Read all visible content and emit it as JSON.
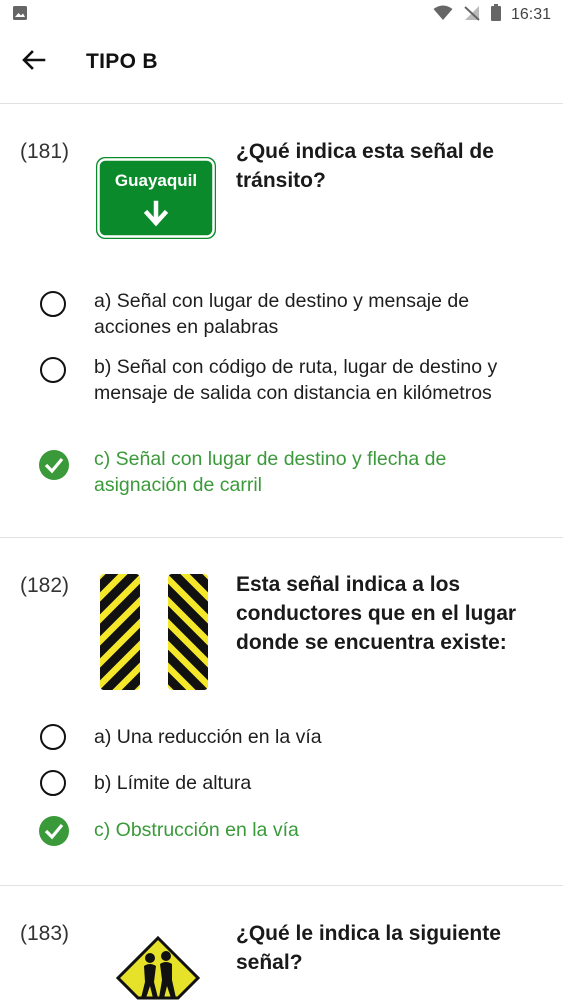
{
  "status_bar": {
    "time": "16:31",
    "icons": [
      "image-icon",
      "wifi-icon",
      "no-signal-icon",
      "battery-icon"
    ]
  },
  "app_bar": {
    "title": "TIPO B",
    "back_icon": "arrow-left-icon"
  },
  "colors": {
    "correct": "#3a9a3a",
    "sign_green": "#0b8a2b",
    "sign_yellow": "#f5e72a",
    "sign_black": "#111111"
  },
  "questions": [
    {
      "number": "(181)",
      "text": "¿Qué indica esta señal de tránsito?",
      "sign_text": "Guayaquil",
      "options": [
        {
          "label": "a) Señal con lugar de destino y mensaje de acciones en palabras",
          "selected": false
        },
        {
          "label": "b) Señal con código de ruta, lugar de destino y mensaje de salida con distancia en kilómetros",
          "selected": false
        },
        {
          "label": "c) Señal con lugar de destino y flecha de asignación de carril",
          "selected": true
        }
      ]
    },
    {
      "number": "(182)",
      "text": "Esta señal indica a los conductores que en el lugar donde se encuentra existe:",
      "options": [
        {
          "label": "a) Una reducción en la vía",
          "selected": false
        },
        {
          "label": "b) Límite de altura",
          "selected": false
        },
        {
          "label": "c) Obstrucción en la vía",
          "selected": true
        }
      ]
    },
    {
      "number": "(183)",
      "text": "¿Qué le indica la siguiente señal?",
      "options": []
    }
  ]
}
